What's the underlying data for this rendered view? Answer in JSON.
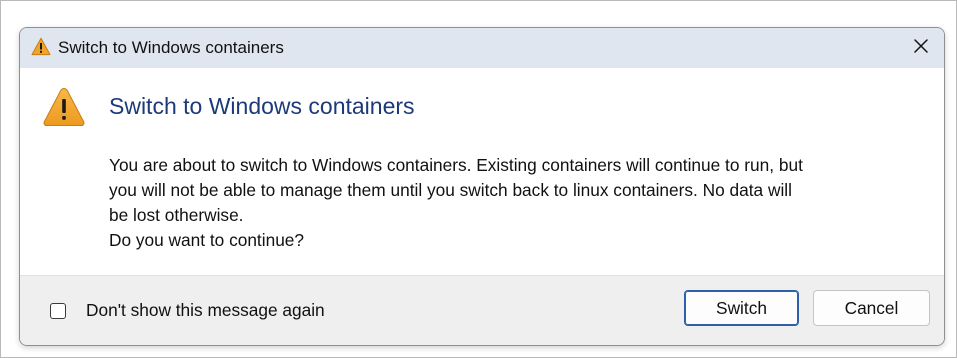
{
  "window": {
    "title": "Switch to Windows containers",
    "title_icon": "warning-icon",
    "close_icon": "close-icon"
  },
  "content": {
    "icon": "warning-icon",
    "main_instruction": "Switch to Windows containers",
    "body_lines": [
      "You are about to switch to Windows containers. Existing containers will continue to run, but",
      "you will not be able to manage them until you switch back to linux containers. No data will",
      "be lost otherwise.",
      "Do you want to continue?"
    ]
  },
  "footer": {
    "checkbox_label": "Don't show this message again",
    "checkbox_checked": false,
    "primary_button": "Switch",
    "secondary_button": "Cancel"
  },
  "colors": {
    "titlebar_bg": "#dfe6ef",
    "main_instruction": "#1c3a7a",
    "warning_fill": "#f2a32a",
    "footer_bg": "#efefef",
    "primary_border": "#2f5fa8"
  }
}
